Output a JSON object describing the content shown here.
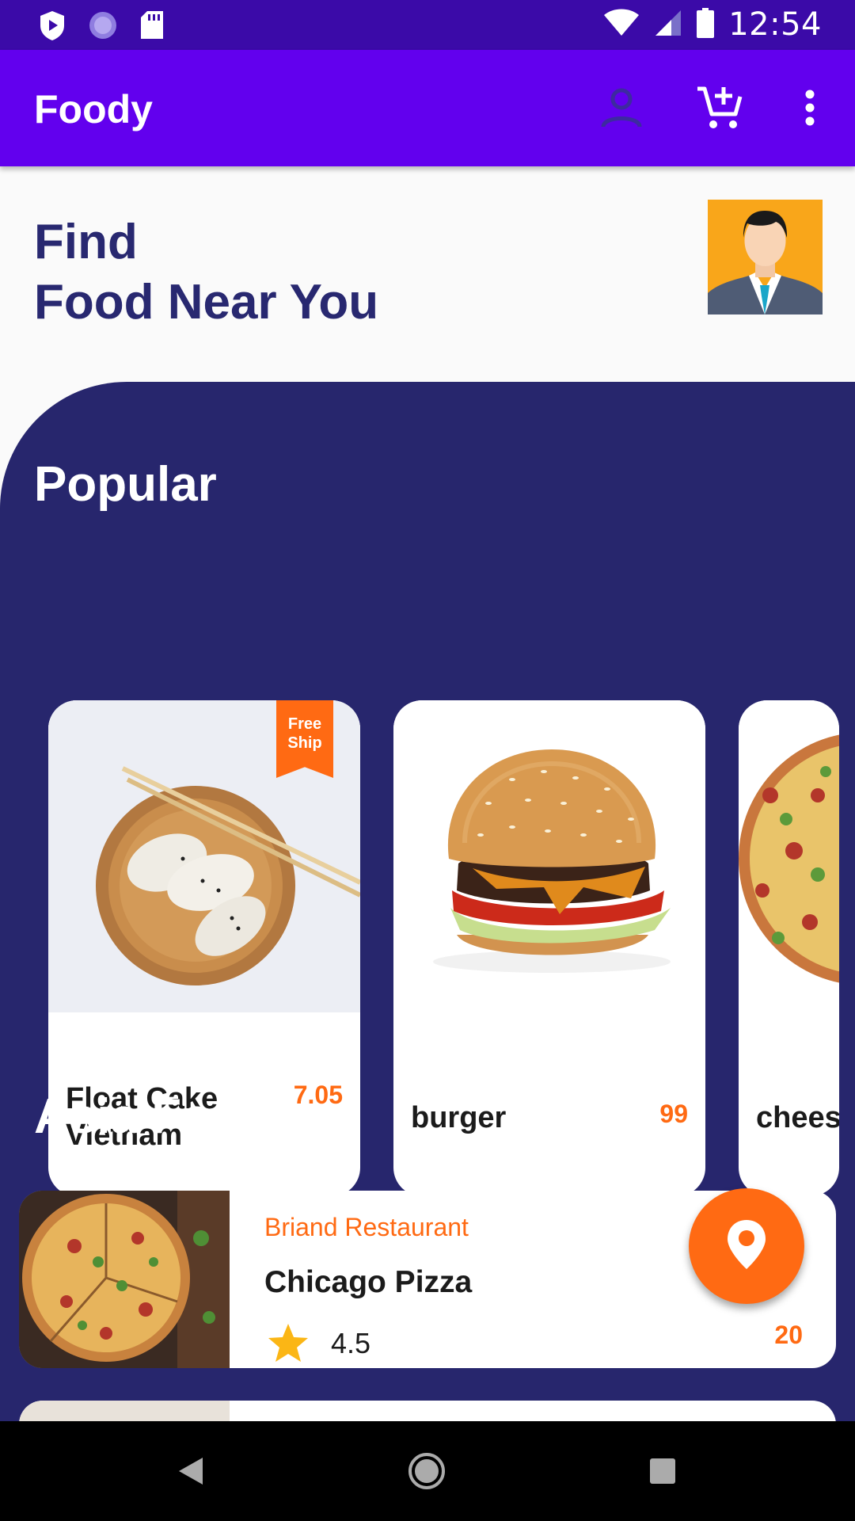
{
  "status_bar": {
    "time": "12:54"
  },
  "app_bar": {
    "title": "Foody"
  },
  "header": {
    "line1": "Find",
    "line2": "Food Near You"
  },
  "popular": {
    "title": "Popular",
    "items": [
      {
        "name": "Float Cake Vietnam",
        "price": "7.05",
        "badge": "Free Ship"
      },
      {
        "name": "burger",
        "price": "99"
      },
      {
        "name": "chees"
      }
    ]
  },
  "asia": {
    "title": "Asia Food",
    "items": [
      {
        "restaurant": "Briand Restaurant",
        "name": "Chicago Pizza",
        "rating": "4.5",
        "price": "20"
      }
    ]
  },
  "colors": {
    "app_bar": "#6200ee",
    "panel": "#27266d",
    "accent": "#ff6a13",
    "headline": "#282870"
  },
  "icons": [
    "play-shield-icon",
    "sync-icon",
    "sd-card-icon",
    "wifi-icon",
    "cell-signal-icon",
    "battery-icon",
    "person-icon",
    "add-cart-icon",
    "more-vert-icon",
    "location-pin-icon",
    "star-icon",
    "back-icon",
    "home-icon",
    "recents-icon"
  ]
}
